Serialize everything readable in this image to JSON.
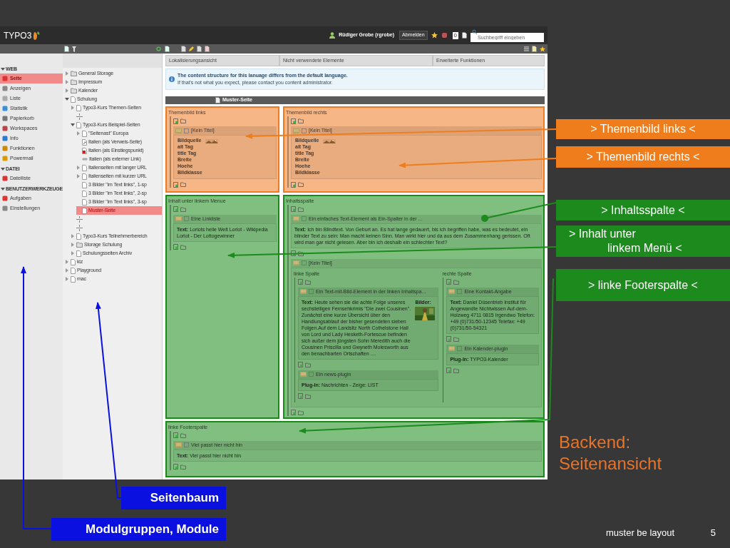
{
  "topbar": {
    "logo": "TYPO3",
    "user": "Rüdiger Grobe (rgrobe)",
    "logout": "Abmelden",
    "badge": "0",
    "search_placeholder": "Suchbegriff eingeben"
  },
  "modules": [
    {
      "title": "WEB",
      "expanded": true,
      "items": [
        {
          "label": "Seite",
          "selected": true
        },
        {
          "label": "Anzeigen",
          "selected": false
        },
        {
          "label": "Liste",
          "selected": false
        },
        {
          "label": "Statistik",
          "selected": false
        },
        {
          "label": "Papierkorb",
          "selected": false
        },
        {
          "label": "Workspaces",
          "selected": false
        },
        {
          "label": "Info",
          "selected": false
        },
        {
          "label": "Funktionen",
          "selected": false
        },
        {
          "label": "Powermail",
          "selected": false
        }
      ]
    },
    {
      "title": "DATEI",
      "expanded": true,
      "items": [
        {
          "label": "Dateiliste",
          "selected": false
        }
      ]
    },
    {
      "title": "BENUTZERWERKZEUGE",
      "expanded": true,
      "items": [
        {
          "label": "Aufgaben",
          "selected": false
        },
        {
          "label": "Einstellungen",
          "selected": false
        }
      ]
    }
  ],
  "page_tree": [
    {
      "label": "General Storage",
      "kind": "folder",
      "expanded": false,
      "selected": false
    },
    {
      "label": "Impressum",
      "kind": "folder",
      "expanded": false,
      "selected": false
    },
    {
      "label": "Kalender",
      "kind": "folder",
      "expanded": false,
      "selected": false
    },
    {
      "label": "Schulung",
      "kind": "page",
      "expanded": true,
      "selected": false,
      "children": [
        {
          "label": "Typo3-Kurs Themen-Seiten",
          "kind": "page",
          "expanded": false,
          "selected": false
        },
        {
          "kind": "separator",
          "selected": false
        },
        {
          "label": "Typo3-Kurs Beispiel-Seiten",
          "kind": "page",
          "expanded": true,
          "selected": false,
          "children": [
            {
              "label": "\"Seitenast\" Europa",
              "kind": "page",
              "expanded": false,
              "selected": false
            },
            {
              "label": "Italien (als Verweis-Seite)",
              "kind": "shortcut",
              "selected": false
            },
            {
              "label": "Italien (als Einstiegspunkt)",
              "kind": "mountpoint",
              "selected": false
            },
            {
              "label": "Italien (als externer Link)",
              "kind": "link",
              "selected": false
            },
            {
              "label": "Italienseiten mit langer URL",
              "kind": "page",
              "expanded": false,
              "selected": false
            },
            {
              "label": "Italienseiten mit kurzer URL",
              "kind": "page",
              "expanded": false,
              "selected": false
            },
            {
              "label": "3 Bilder \"im Text links\", 1-sp",
              "kind": "page",
              "selected": false
            },
            {
              "label": "3 Bilder \"im Text links\", 2-sp",
              "kind": "page",
              "selected": false
            },
            {
              "label": "3 Bilder \"im Text links\", 3-sp",
              "kind": "page",
              "selected": false
            },
            {
              "label": "Muster-Seite",
              "kind": "page",
              "selected": true
            }
          ]
        },
        {
          "kind": "separator",
          "selected": false
        },
        {
          "kind": "separator",
          "selected": false
        },
        {
          "label": "Typo3-Kurs Teilnehmerbereich",
          "kind": "page",
          "expanded": false,
          "selected": false
        },
        {
          "label": "Storage Schulung",
          "kind": "folder",
          "expanded": false,
          "selected": false
        },
        {
          "label": "Schulungsseiten Archiv",
          "kind": "page",
          "expanded": false,
          "selected": false
        }
      ]
    },
    {
      "label": "kiz",
      "kind": "page",
      "expanded": false,
      "selected": false
    },
    {
      "label": "Playground",
      "kind": "page",
      "expanded": false,
      "selected": false
    },
    {
      "label": "mac",
      "kind": "page",
      "expanded": false,
      "selected": false
    }
  ],
  "panels": [
    "Lokalisierungsansicht",
    "Nicht verwendete Elemente",
    "Erweiterte Funktionen"
  ],
  "info": {
    "title": "The content structure for this lanuage differs from the default language.",
    "text": "If that's not what you expect, please contact you content administrator."
  },
  "page_header": "Muster-Seite",
  "rows": [
    [
      {
        "title": "Themenbild links",
        "color": "#ee7a22",
        "elements": [
          {
            "title": "[Kein Titel]",
            "fields": [
              "Bildquelle",
              "alt Tag",
              "title Tag",
              "Breite",
              "Hoehe",
              "Bildklasse"
            ]
          }
        ]
      },
      {
        "title": "Themenbild rechts",
        "color": "#ee7a22",
        "elements": [
          {
            "title": "[Kein Titel]",
            "fields": [
              "Bildquelle",
              "alt Tag",
              "title Tag",
              "Breite",
              "Hoehe",
              "Bildklasse"
            ]
          }
        ]
      }
    ],
    [
      {
        "title": "Inhalt unter linkem Menue",
        "color": "#178a17",
        "elements": [
          {
            "kind": "text",
            "title": "Eine Linkliste",
            "body": "**Text:** Loriots heile Welt Loriot - Wikipedia Loriot - Der Lottogewinner"
          }
        ]
      },
      {
        "title": "Inhaltsspalte",
        "color": "#178a17",
        "elements": [
          {
            "kind": "text",
            "title": "Ein einfaches Text-Element als Ein-Spalter in der ...",
            "body": "**Text:** Ich bin Blindtext. Von Geburt an. Es hat lange gedauert, bis ich begriffen habe, was es bedeutet, ein blinder Text zu sein: Man macht keinen Sinn. Man wirkt hier und da aus dem Zusammenhang gerissen. Oft wird man gar nicht gelesen. Aber bin ich deshalb ein schlechter Text?"
          },
          {
            "kind": "grid",
            "title": "[Kein Titel]",
            "columns": [
              {
                "title": "linke Spalte",
                "elements": [
                  {
                    "kind": "textpic",
                    "title": "Ein Text-mit-Bild-Element in der linken Inhaltspa...",
                    "body": "**Text:** Heute sehen sie die achte Folge unseres sechsteiligen Fernsehkrimis \"Die zwei Cousinen\". Zunächst eine kurze Übersicht über den Handlungsablauf der bisher gesendeten sieben Folgen.Auf dem Landsitz North Cothelstone Hall von Lord und Lady Hesketh-Fortescue befinden sich außer dem jüngsten Sohn Meredith auch die Cousinen Priscilla und Gwyneth Molesworth aus den benachbarten Ortschaften ....",
                    "images_label": "Bilder:"
                  },
                  {
                    "kind": "text",
                    "title": "Ein news-plugin",
                    "body": "**Plug-In:** Nachrichten - Zeige: LIST"
                  }
                ]
              },
              {
                "title": "rechte Spalte",
                "elements": [
                  {
                    "kind": "text",
                    "title": "Eine Kontakt-Angabe",
                    "body": "**Text:** Daniel Düsentrieb Institut für Angewandte Nichtwissen Auf-dem-Holzweg 4711 0815 Irgendwo Telefon: +49 (0)731/50-12345 Telefax: +49 (0)731/50-54321"
                  },
                  {
                    "kind": "text",
                    "title": "Ein Kalender-plugin",
                    "body": "**Plug-In:** TYPO3-Kalender"
                  }
                ]
              }
            ]
          }
        ]
      }
    ],
    [
      {
        "title": "linke Footerspalte",
        "color": "#178a17",
        "elements": [
          {
            "kind": "text",
            "title": "Viel passt hier nicht hin",
            "body": "**Text:** Viel passt hier nicht hin"
          }
        ]
      }
    ]
  ],
  "annotations": [
    {
      "lines": [
        "> Themenbild links <"
      ],
      "color": "#f07d1c"
    },
    {
      "lines": [
        "> Themenbild rechts <"
      ],
      "color": "#f07d1c"
    },
    {
      "lines": [
        "> Inhaltsspalte <"
      ],
      "color": "#1c8a1c"
    },
    {
      "lines": [
        "> Inhalt unter",
        "linkem Menü <"
      ],
      "color": "#1c8a1c"
    },
    {
      "lines": [
        "> linke Footerspalte <"
      ],
      "color": "#1c8a1c"
    }
  ],
  "slide_title": [
    "Backend:",
    "Seitenansicht"
  ],
  "labels": [
    {
      "text": "Seitenbaum",
      "color": "#0a10e0"
    },
    {
      "text": "Modulgruppen, Module",
      "color": "#0a10e0"
    }
  ],
  "footer": {
    "text": "muster be layout",
    "page": "5"
  }
}
